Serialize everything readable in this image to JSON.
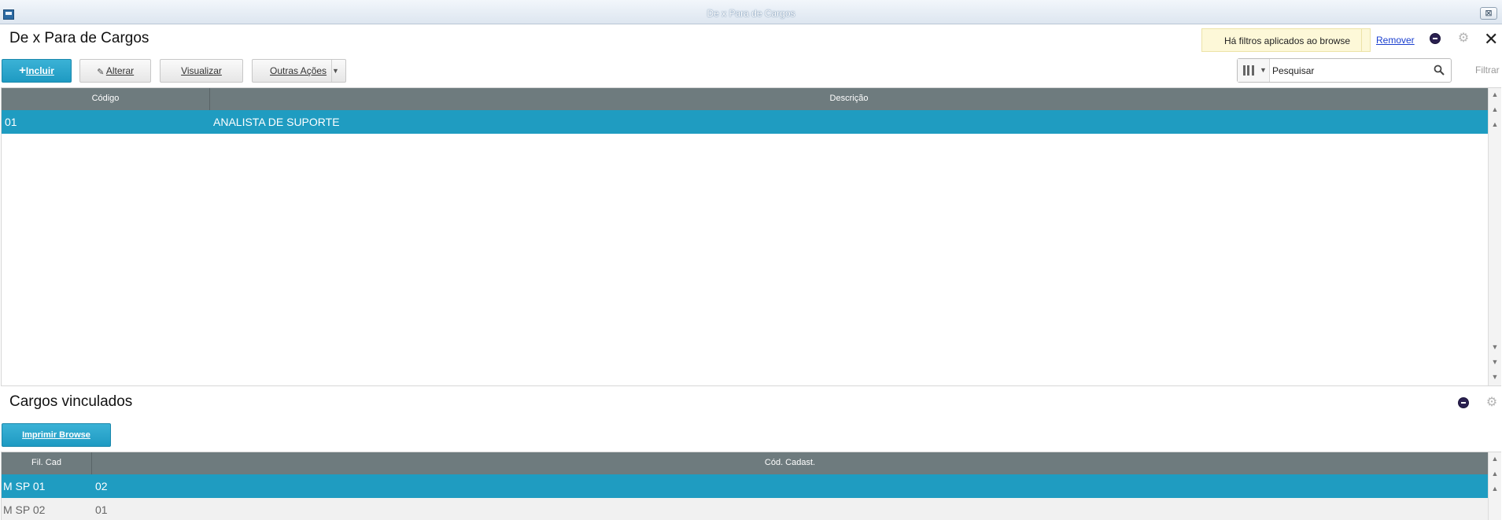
{
  "window": {
    "title": "De x Para de Cargos",
    "close_glyph": "⊠"
  },
  "header": {
    "title": "De x Para de Cargos",
    "filter_notice": "Há filtros aplicados ao browse",
    "filter_remove": "Remover",
    "close_glyph": "✕"
  },
  "toolbar": {
    "add_plus": "+",
    "add_label": "Incluir",
    "edit_label": "Alterar",
    "view_label": "Visualizar",
    "more_label": "Outras Ações",
    "more_caret": "▼"
  },
  "search": {
    "placeholder": "Pesquisar",
    "value": "",
    "caret": "▼",
    "filter_label": "Filtrar"
  },
  "main_grid": {
    "columns": [
      "Código",
      "Descrição"
    ],
    "rows": [
      {
        "codigo": "01",
        "descricao": "ANALISTA DE SUPORTE"
      }
    ]
  },
  "linked": {
    "title": "Cargos vinculados",
    "print_label": "Imprimir Browse",
    "columns": [
      "Fil. Cad",
      "Cód. Cadast."
    ],
    "rows": [
      {
        "fil": "M SP 01",
        "cod": "02"
      },
      {
        "fil": "M SP 02",
        "cod": "01"
      }
    ]
  },
  "colors": {
    "accent": "#1f9cc1",
    "grid_header": "#6e7b7e",
    "notice_bg": "#fdf8d8",
    "link": "#1a3fcf"
  },
  "icons": [
    "window-icon",
    "window-close-icon",
    "legend-icon",
    "gear-icon",
    "close-icon",
    "plus-icon",
    "pencil-icon",
    "columns-icon",
    "search-icon",
    "scroll-arrow-icon"
  ]
}
